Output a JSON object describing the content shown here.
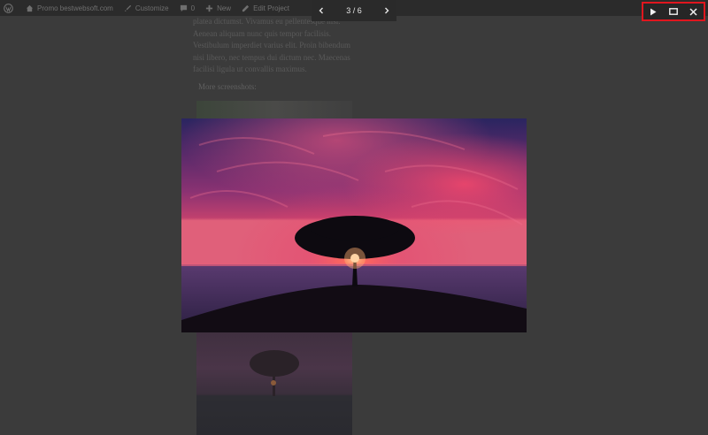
{
  "adminbar": {
    "site_name": "Promo bestwebsoft.com",
    "customize": "Customize",
    "comments_count": "0",
    "new_label": "New",
    "edit_label": "Edit Project"
  },
  "content": {
    "paragraph": "platea dictumst. Vivamus eu pellentesque nisl. Aenean aliquam nunc quis tempor facilisis. Vestibulum imperdiet varius elit. Proin bibendum nisi libero, nec tempus dui dictum nec. Maecenas facilisi ligula ut convallis maximus.",
    "more_heading": "More screenshots:"
  },
  "lightbox": {
    "counter": "3 / 6",
    "prev_icon": "chevron-left-icon",
    "next_icon": "chevron-right-icon",
    "controls": {
      "play_icon": "play-icon",
      "fullscreen_icon": "maximize-icon",
      "close_icon": "close-icon",
      "highlight_color": "#e0161e"
    }
  },
  "colors": {
    "overlay": "#3b3b3b",
    "bar": "#2b2b2b",
    "sky_top": "#2a2560",
    "sky_glow": "#e8406a",
    "sea": "#3a2a55"
  }
}
